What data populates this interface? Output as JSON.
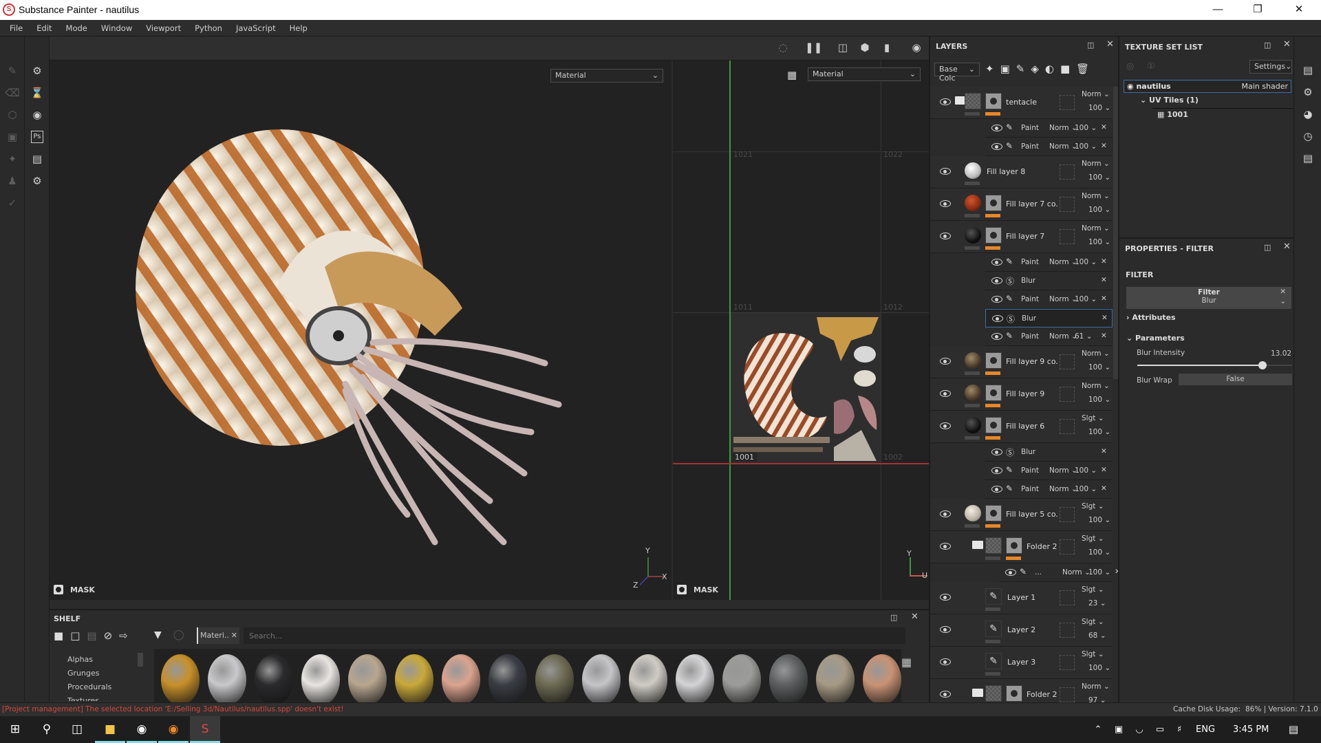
{
  "window": {
    "title": "Substance Painter - nautilus",
    "logo_text": "S"
  },
  "menu": [
    "File",
    "Edit",
    "Mode",
    "Window",
    "Viewport",
    "Python",
    "JavaScript",
    "Help"
  ],
  "viewport3d": {
    "channel_select": "Material",
    "mask_label": "MASK",
    "axes": {
      "y": "Y",
      "x": "X",
      "z": "Z"
    }
  },
  "viewport2d": {
    "channel_select": "Material",
    "mask_label": "MASK",
    "tiles": [
      "1021",
      "1022",
      "1011",
      "1012",
      "1001",
      "1002"
    ],
    "axes": {
      "y": "Y",
      "u": "U"
    }
  },
  "layers": {
    "title": "LAYERS",
    "channel": "Base Colc",
    "rows": [
      {
        "kind": "layer",
        "name": "tentacle",
        "thumb": "checker",
        "folder": true,
        "mask": true,
        "depth": 0,
        "blend": "Norm",
        "opacity": "100"
      },
      {
        "kind": "effect",
        "icon": "brush",
        "name": "Paint",
        "blend": "Norm",
        "opacity": "100",
        "depth": 0
      },
      {
        "kind": "effect",
        "icon": "brush",
        "name": "Paint",
        "blend": "Norm",
        "opacity": "100",
        "depth": 0
      },
      {
        "kind": "layer",
        "name": "Fill layer 8",
        "thumb": "white",
        "mask": false,
        "depth": 0,
        "blend": "Norm",
        "opacity": "100"
      },
      {
        "kind": "layer",
        "name": "Fill layer 7 co...",
        "thumb": "red",
        "mask": true,
        "depth": 0,
        "blend": "Norm",
        "opacity": "100"
      },
      {
        "kind": "layer",
        "name": "Fill layer 7",
        "thumb": "black",
        "mask": true,
        "depth": 0,
        "blend": "Norm",
        "opacity": "100"
      },
      {
        "kind": "effect",
        "icon": "brush",
        "name": "Paint",
        "blend": "Norm",
        "opacity": "100",
        "depth": 0
      },
      {
        "kind": "effect",
        "icon": "filter",
        "name": "Blur",
        "depth": 0
      },
      {
        "kind": "effect",
        "icon": "brush",
        "name": "Paint",
        "blend": "Norm",
        "opacity": "100",
        "depth": 0
      },
      {
        "kind": "effect",
        "icon": "filter",
        "name": "Blur",
        "depth": 0,
        "selected": true
      },
      {
        "kind": "effect",
        "icon": "brush",
        "name": "Paint",
        "blend": "Norm",
        "opacity": "61",
        "depth": 0
      },
      {
        "kind": "layer",
        "name": "Fill layer 9 co...",
        "thumb": "rock",
        "mask": true,
        "depth": 0,
        "blend": "Norm",
        "opacity": "100"
      },
      {
        "kind": "layer",
        "name": "Fill layer 9",
        "thumb": "rock",
        "mask": true,
        "depth": 0,
        "blend": "Norm",
        "opacity": "100"
      },
      {
        "kind": "layer",
        "name": "Fill layer 6",
        "thumb": "black",
        "mask": true,
        "depth": 0,
        "blend": "Slgt",
        "opacity": "100"
      },
      {
        "kind": "effect",
        "icon": "filter",
        "name": "Blur",
        "depth": 0
      },
      {
        "kind": "effect",
        "icon": "brush",
        "name": "Paint",
        "blend": "Norm",
        "opacity": "100",
        "depth": 0
      },
      {
        "kind": "effect",
        "icon": "brush",
        "name": "Paint",
        "blend": "Norm",
        "opacity": "100",
        "depth": 0
      },
      {
        "kind": "layer",
        "name": "Fill layer 5 co...",
        "thumb": "cream",
        "mask": true,
        "depth": 0,
        "blend": "Slgt",
        "opacity": "100"
      },
      {
        "kind": "layer",
        "name": "Folder 2 ...",
        "thumb": "checker",
        "folder": true,
        "mask": true,
        "depth": 1,
        "blend": "Slgt",
        "opacity": "100"
      },
      {
        "kind": "effect",
        "icon": "brush",
        "name": "...",
        "blend": "Norm",
        "opacity": "100",
        "depth": 1
      },
      {
        "kind": "layer",
        "name": "Layer 1",
        "thumb": "brush",
        "mask": false,
        "depth": 1,
        "blend": "Slgt",
        "opacity": "23"
      },
      {
        "kind": "layer",
        "name": "Layer 2",
        "thumb": "brush",
        "mask": false,
        "depth": 1,
        "blend": "Slgt",
        "opacity": "68"
      },
      {
        "kind": "layer",
        "name": "Layer 3",
        "thumb": "brush",
        "mask": false,
        "depth": 1,
        "blend": "Slgt",
        "opacity": "100"
      },
      {
        "kind": "layer",
        "name": "Folder 2 ...",
        "thumb": "checker",
        "folder": true,
        "mask": true,
        "depth": 1,
        "blend": "Norm",
        "opacity": "97"
      }
    ]
  },
  "texture_set": {
    "title": "TEXTURE SET LIST",
    "settings": "Settings",
    "set_name": "nautilus",
    "shader": "Main shader",
    "uv_tiles": "UV Tiles (1)",
    "tile": "1001"
  },
  "properties": {
    "title": "PROPERTIES - FILTER",
    "section": "FILTER",
    "filter_label": "Filter",
    "filter_value": "Blur",
    "attributes": "Attributes",
    "parameters": "Parameters",
    "blur_intensity_label": "Blur Intensity",
    "blur_intensity": "13.02",
    "blur_intensity_fraction": 0.81,
    "blur_wrap_label": "Blur Wrap",
    "blur_wrap": "False"
  },
  "shelf": {
    "title": "SHELF",
    "filter_tag": "Materi..",
    "search_placeholder": "Search...",
    "categories": [
      "Alphas",
      "Grunges",
      "Procedurals",
      "Textures"
    ],
    "material_colors": [
      "#c8902a",
      "#c9c9cb",
      "#2a2a2c",
      "#e8e4e0",
      "#b8a690",
      "#c9a93a",
      "#dba38e",
      "#3a3d44",
      "#6d6a52",
      "#c5c5c8",
      "#cfccc4",
      "#d4d4d6",
      "#9c9c9a",
      "#5d5f60",
      "#a69a84",
      "#c99274"
    ]
  },
  "status": {
    "message": "[Project management] The selected location 'E:/Selling 3d/Nautilus/nautilus.spp' doesn't exist!",
    "cache_label": "Cache Disk Usage:",
    "cache_value": "86% | Version: 7.1.0"
  },
  "taskbar": {
    "lang": "ENG",
    "time": "3:45 PM"
  },
  "colors": {
    "accent_orange": "#e8872a",
    "selection": "#3d6fa8",
    "error": "#d9483b"
  }
}
